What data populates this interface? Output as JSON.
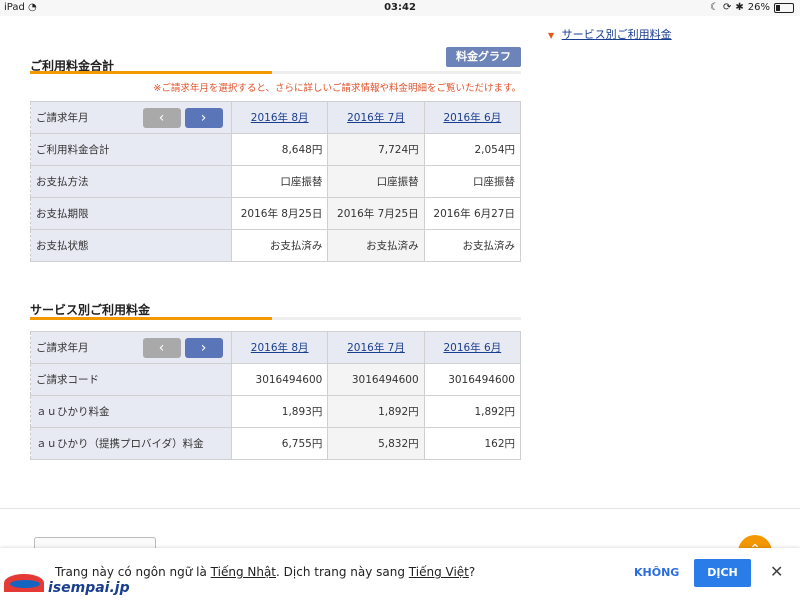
{
  "status_bar": {
    "device": "iPad",
    "wifi_icon": "wifi-icon",
    "time": "03:42",
    "battery_percent": "26%",
    "battery_level": 0.26,
    "icons": [
      "moon-icon",
      "rotation-lock-icon",
      "bluetooth-icon",
      "battery-icon"
    ]
  },
  "side_link": {
    "label": "サービス別ご利用料金"
  },
  "summary": {
    "title": "ご利用料金合計",
    "graph_button": "料金グラフ",
    "note": "※ご請求年月を選択すると、さらに詳しいご請求情報や料金明細をご覧いただけます。",
    "header_label": "ご請求年月",
    "months": [
      "2016年 8月",
      "2016年 7月",
      "2016年 6月"
    ],
    "rows": [
      {
        "label": "ご利用料金合計",
        "values": [
          "8,648円",
          "7,724円",
          "2,054円"
        ]
      },
      {
        "label": "お支払方法",
        "values": [
          "口座振替",
          "口座振替",
          "口座振替"
        ]
      },
      {
        "label": "お支払期限",
        "values": [
          "2016年 8月25日",
          "2016年 7月25日",
          "2016年 6月27日"
        ]
      },
      {
        "label": "お支払状態",
        "values": [
          "お支払済み",
          "お支払済み",
          "お支払済み"
        ]
      }
    ]
  },
  "service": {
    "title": "サービス別ご利用料金",
    "header_label": "ご請求年月",
    "months": [
      "2016年 8月",
      "2016年 7月",
      "2016年 6月"
    ],
    "rows": [
      {
        "label": "ご請求コード",
        "values": [
          "3016494600",
          "3016494600",
          "3016494600"
        ]
      },
      {
        "label": "ａｕひかり料金",
        "values": [
          "1,893円",
          "1,892円",
          "1,892円"
        ]
      },
      {
        "label": "ａｕひかり（提携プロバイダ）料金",
        "values": [
          "6,755円",
          "5,832円",
          "162円"
        ]
      }
    ]
  },
  "nav": {
    "prev": "‹",
    "next": "›"
  },
  "translate_bar": {
    "text_before": "Trang này có ngôn ngữ là ",
    "source_lang": "Tiếng Nhật",
    "text_middle": ". Dịch trang này sang ",
    "target_lang": "Tiếng Việt",
    "text_after": "?",
    "no_button": "KHÔNG",
    "yes_button": "DỊCH",
    "close": "✕"
  },
  "watermark": {
    "logo_text": "isempai.jp"
  },
  "colors": {
    "accent": "#f39800",
    "link": "#1a3e8f",
    "nav_active": "#5a76b8",
    "translate_blue": "#2a7de8"
  }
}
